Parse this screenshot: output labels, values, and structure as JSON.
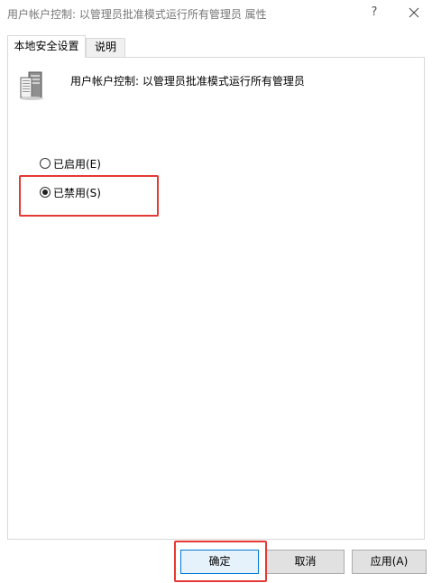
{
  "window": {
    "title": "用户帐户控制: 以管理员批准模式运行所有管理员 属性",
    "help_label": "?"
  },
  "tabs": [
    {
      "label": "本地安全设置",
      "active": true
    },
    {
      "label": "说明",
      "active": false
    }
  ],
  "policy": {
    "icon": "server-policy-icon",
    "name": "用户帐户控制: 以管理员批准模式运行所有管理员"
  },
  "options": [
    {
      "label": "已启用(E)",
      "checked": false
    },
    {
      "label": "已禁用(S)",
      "checked": true
    }
  ],
  "buttons": {
    "ok": "确定",
    "cancel": "取消",
    "apply": "应用(A)"
  },
  "colors": {
    "highlight": "#e53935",
    "default_button_border": "#0078d7"
  }
}
